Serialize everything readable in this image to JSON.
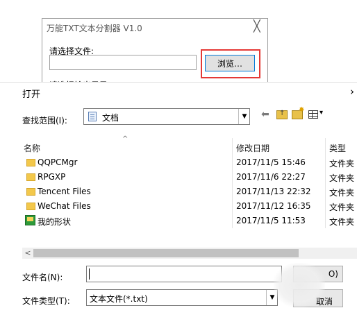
{
  "app_window": {
    "title": "万能TXT文本分割器  V1.0",
    "close_glyph": "╳",
    "select_file_label": "请选择文件:",
    "file_path_value": "",
    "browse_button_label": "浏览…",
    "output_dir_label": "请选择输出目录:",
    "highlight_color": "#e53935"
  },
  "dialog": {
    "title": "打开",
    "close_glyph": "›",
    "lookin_label": "查找范围(I):",
    "lookin_value": "文档",
    "toolbar": {
      "back_glyph": "⬅",
      "up_glyph": "↑",
      "new_folder_glyph": "✸",
      "view_arrow_glyph": "▾"
    },
    "sort_glyph": "^",
    "columns": {
      "name": "名称",
      "date": "修改日期",
      "type": "类型"
    },
    "rows": [
      {
        "icon": "folder-icon",
        "name": "QQPCMgr",
        "date": "2017/11/5 15:46",
        "type": "文件夹"
      },
      {
        "icon": "folder-icon",
        "name": "RPGXP",
        "date": "2017/11/6 22:27",
        "type": "文件夹"
      },
      {
        "icon": "folder-icon",
        "name": "Tencent Files",
        "date": "2017/11/13 22:32",
        "type": "文件夹"
      },
      {
        "icon": "folder-icon",
        "name": "WeChat Files",
        "date": "2017/11/12 16:35",
        "type": "文件夹"
      },
      {
        "icon": "shape-file-icon",
        "name": "我的形状",
        "date": "2017/11/5 11:53",
        "type": "文件夹"
      }
    ],
    "scroll_left_glyph": "<",
    "filename_label": "文件名(N):",
    "filename_value": "",
    "filetype_label": "文件类型(T):",
    "filetype_value": "文本文件(*.txt)",
    "open_button_label": "O)",
    "cancel_button_label": "取消"
  }
}
